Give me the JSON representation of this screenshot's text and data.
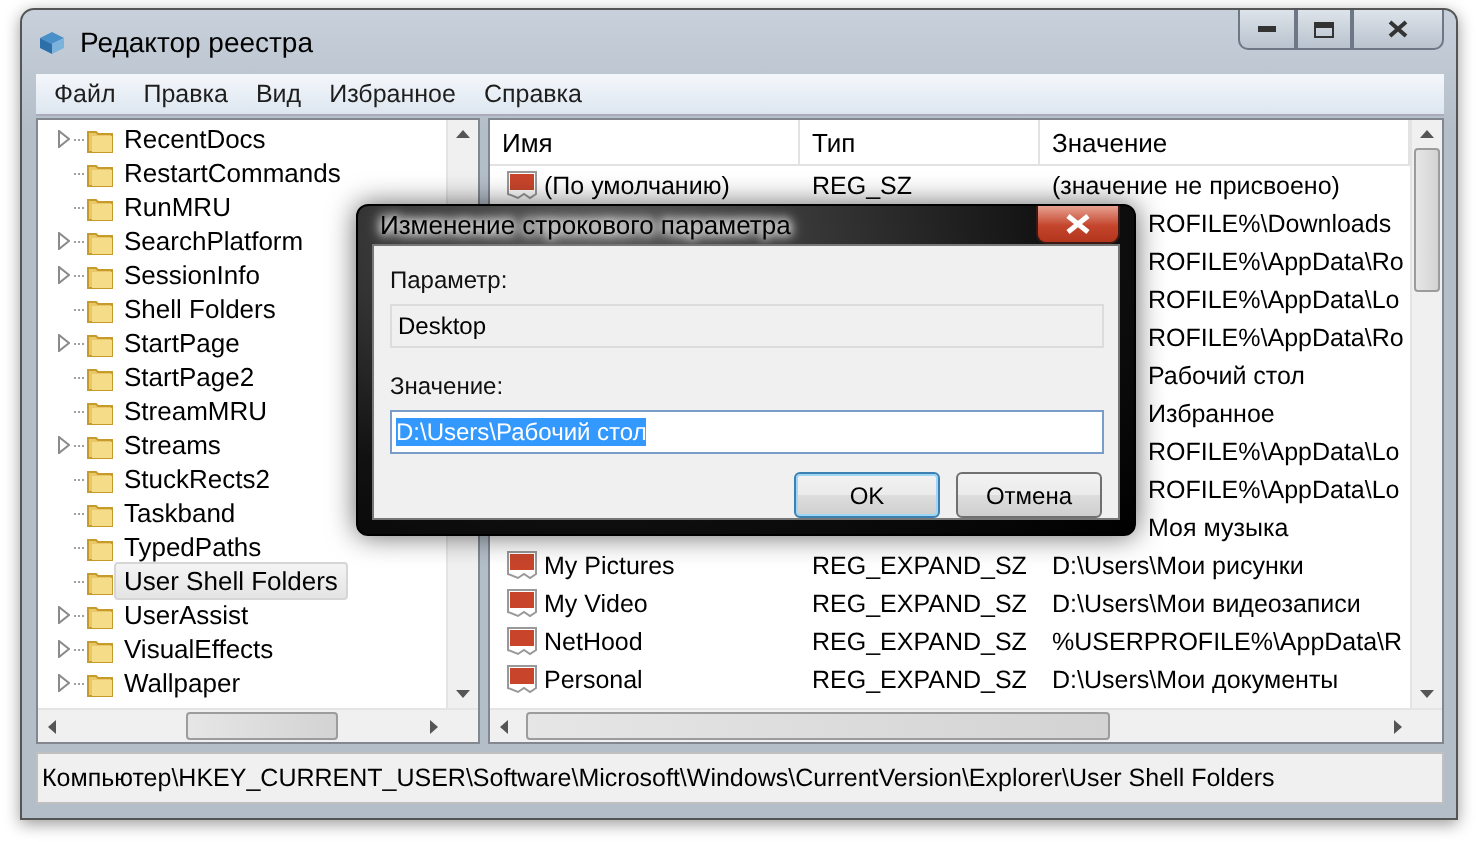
{
  "window": {
    "title": "Редактор реестра"
  },
  "menu": [
    {
      "label": "Файл"
    },
    {
      "label": "Правка"
    },
    {
      "label": "Вид"
    },
    {
      "label": "Избранное"
    },
    {
      "label": "Справка"
    }
  ],
  "tree": {
    "items": [
      {
        "label": "RecentDocs",
        "expandable": true,
        "selected": false
      },
      {
        "label": "RestartCommands",
        "expandable": false,
        "selected": false
      },
      {
        "label": "RunMRU",
        "expandable": false,
        "selected": false
      },
      {
        "label": "SearchPlatform",
        "expandable": true,
        "selected": false
      },
      {
        "label": "SessionInfo",
        "expandable": true,
        "selected": false
      },
      {
        "label": "Shell Folders",
        "expandable": false,
        "selected": false
      },
      {
        "label": "StartPage",
        "expandable": true,
        "selected": false
      },
      {
        "label": "StartPage2",
        "expandable": false,
        "selected": false
      },
      {
        "label": "StreamMRU",
        "expandable": false,
        "selected": false
      },
      {
        "label": "Streams",
        "expandable": true,
        "selected": false
      },
      {
        "label": "StuckRects2",
        "expandable": false,
        "selected": false
      },
      {
        "label": "Taskband",
        "expandable": false,
        "selected": false
      },
      {
        "label": "TypedPaths",
        "expandable": false,
        "selected": false
      },
      {
        "label": "User Shell Folders",
        "expandable": false,
        "selected": true
      },
      {
        "label": "UserAssist",
        "expandable": true,
        "selected": false
      },
      {
        "label": "VisualEffects",
        "expandable": true,
        "selected": false
      },
      {
        "label": "Wallpaper",
        "expandable": true,
        "selected": false
      }
    ]
  },
  "list": {
    "columns": [
      {
        "label": "Имя"
      },
      {
        "label": "Тип"
      },
      {
        "label": "Значение"
      }
    ],
    "rows": [
      {
        "kind": "full",
        "name": "(По умолчанию)",
        "type": "REG_SZ",
        "value": "(значение не присвоено)"
      },
      {
        "kind": "tail",
        "value": "ROFILE%\\Downloads"
      },
      {
        "kind": "tail",
        "value": "ROFILE%\\AppData\\Ro"
      },
      {
        "kind": "tail",
        "value": "ROFILE%\\AppData\\Lo"
      },
      {
        "kind": "tail",
        "value": "ROFILE%\\AppData\\Ro"
      },
      {
        "kind": "tail",
        "value": "Рабочий стол"
      },
      {
        "kind": "tail",
        "value": "Избранное"
      },
      {
        "kind": "tail",
        "value": "ROFILE%\\AppData\\Lo"
      },
      {
        "kind": "tail",
        "value": "ROFILE%\\AppData\\Lo"
      },
      {
        "kind": "tail",
        "value": "Моя музыка"
      },
      {
        "kind": "full",
        "name": "My Pictures",
        "type": "REG_EXPAND_SZ",
        "value": "D:\\Users\\Мои рисунки"
      },
      {
        "kind": "full",
        "name": "My Video",
        "type": "REG_EXPAND_SZ",
        "value": "D:\\Users\\Мои видеозаписи"
      },
      {
        "kind": "full",
        "name": "NetHood",
        "type": "REG_EXPAND_SZ",
        "value": "%USERPROFILE%\\AppData\\R"
      },
      {
        "kind": "full",
        "name": "Personal",
        "type": "REG_EXPAND_SZ",
        "value": "D:\\Users\\Мои документы"
      }
    ]
  },
  "dialog": {
    "title": "Изменение строкового параметра",
    "parameter_label": "Параметр:",
    "parameter_value": "Desktop",
    "value_label": "Значение:",
    "value": "D:\\Users\\Рабочий стол",
    "value_selected": true,
    "buttons": [
      {
        "label": "OK",
        "default": true
      },
      {
        "label": "Отмена",
        "default": false
      }
    ]
  },
  "status_bar": "Компьютер\\HKEY_CURRENT_USER\\Software\\Microsoft\\Windows\\CurrentVersion\\Explorer\\User Shell Folders"
}
